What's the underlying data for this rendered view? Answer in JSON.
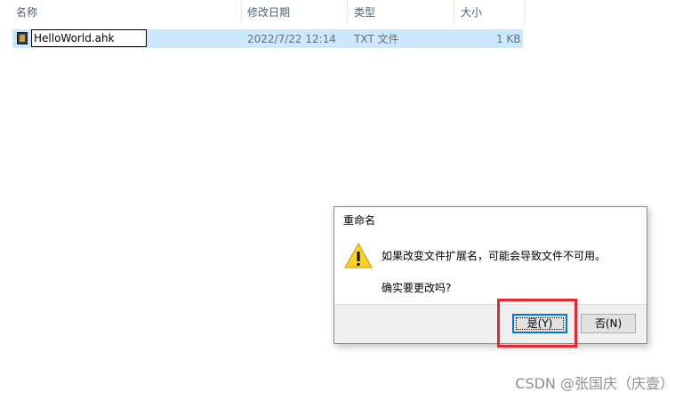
{
  "columns": {
    "name": "名称",
    "modified": "修改日期",
    "type": "类型",
    "size": "大小"
  },
  "file": {
    "name_edit_value": "HelloWorld.ahk",
    "modified": "2022/7/22 12:14",
    "type": "TXT 文件",
    "size": "1 KB"
  },
  "dialog": {
    "title": "重命名",
    "message": "如果改变文件扩展名，可能会导致文件不可用。",
    "question": "确实要更改吗?",
    "yes_label": "是(Y)",
    "no_label": "否(N)"
  },
  "watermark": "CSDN @张国庆（庆壹）",
  "colors": {
    "selection": "#cce8ff",
    "header_text": "#4c607a",
    "highlight_box": "#e8262b",
    "default_button_border": "#0078d7"
  }
}
